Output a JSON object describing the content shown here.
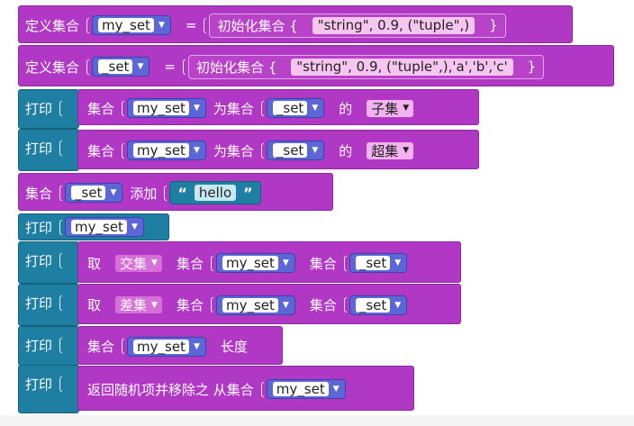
{
  "colors": {
    "set_block": "#b038c4",
    "print_block": "#1f7fa3",
    "variable": "#5b67d6"
  },
  "blocks": {
    "define1": {
      "label": "定义集合",
      "var": "my_set",
      "eq": "=",
      "init_label": "初始化集合 {",
      "literal": "\"string\", 0.9, (\"tuple\",)",
      "close": "}"
    },
    "define2": {
      "label": "定义集合",
      "var": "_set",
      "eq": "=",
      "init_label": "初始化集合 {",
      "literal": "\"string\", 0.9, (\"tuple\",),'a','b','c'",
      "close": "}"
    },
    "print_subset": {
      "print": "打印",
      "set_label": "集合",
      "var1": "my_set",
      "mid": "为集合",
      "var2": "_set",
      "of": "的",
      "option": "子集"
    },
    "print_superset": {
      "print": "打印",
      "set_label": "集合",
      "var1": "my_set",
      "mid": "为集合",
      "var2": "_set",
      "of": "的",
      "option": "超集"
    },
    "add": {
      "set_label": "集合",
      "var": "_set",
      "action": "添加",
      "open_quote": "“",
      "text": "hello",
      "close_quote": "”"
    },
    "print_var": {
      "print": "打印",
      "var": "my_set"
    },
    "print_intersection": {
      "print": "打印",
      "take": "取",
      "option": "交集",
      "set1_label": "集合",
      "var1": "my_set",
      "set2_label": "集合",
      "var2": "_set"
    },
    "print_difference": {
      "print": "打印",
      "take": "取",
      "option": "差集",
      "set1_label": "集合",
      "var1": "my_set",
      "set2_label": "集合",
      "var2": "_set"
    },
    "print_length": {
      "print": "打印",
      "set_label": "集合",
      "var": "my_set",
      "suffix": "长度"
    },
    "print_pop": {
      "print": "打印",
      "text": "返回随机项并移除之 从集合",
      "var": "my_set"
    }
  }
}
